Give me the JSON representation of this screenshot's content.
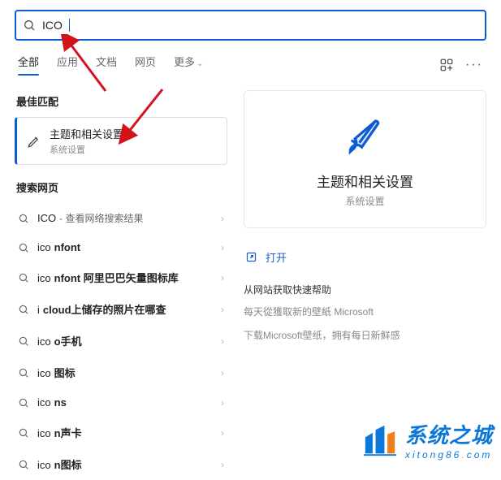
{
  "search": {
    "value": "ICO"
  },
  "tabs": {
    "items": [
      "全部",
      "应用",
      "文档",
      "网页",
      "更多"
    ],
    "active_index": 0
  },
  "sections": {
    "best_match": "最佳匹配",
    "search_web": "搜索网页"
  },
  "best": {
    "title": "主题和相关设置",
    "subtitle": "系统设置"
  },
  "web_results": [
    {
      "prefix": "ICO",
      "bold": "",
      "tail": " - 查看网络搜索结果"
    },
    {
      "prefix": "ico",
      "bold": "nfont",
      "tail": ""
    },
    {
      "prefix": "ico",
      "bold": "nfont 阿里巴巴矢量图标库",
      "tail": ""
    },
    {
      "prefix": "i",
      "bold": "cloud上储存的照片在哪查",
      "tail": ""
    },
    {
      "prefix": "ico",
      "bold": "o手机",
      "tail": ""
    },
    {
      "prefix": "ico",
      "bold": "图标",
      "tail": ""
    },
    {
      "prefix": "ico",
      "bold": "ns",
      "tail": ""
    },
    {
      "prefix": "ico",
      "bold": "n声卡",
      "tail": ""
    },
    {
      "prefix": "ico",
      "bold": "n图标",
      "tail": ""
    }
  ],
  "preview": {
    "title": "主题和相关设置",
    "subtitle": "系统设置",
    "open": "打开",
    "quickhelp_header": "从网站获取快速帮助",
    "link1": "每天從獲取新的壁紙 Microsoft",
    "link2": "下载Microsoft壁纸，拥有每日新鲜感"
  },
  "watermark": {
    "cn": "系统之城",
    "en_parts": [
      "xitong86",
      ".",
      "com"
    ]
  }
}
